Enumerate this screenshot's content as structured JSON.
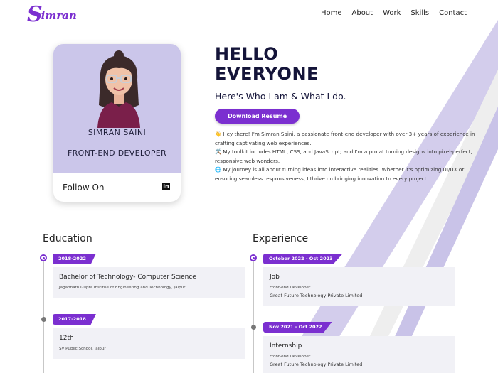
{
  "logo": {
    "initial": "S",
    "rest": "imran"
  },
  "nav": [
    {
      "label": "Home"
    },
    {
      "label": "About"
    },
    {
      "label": "Work"
    },
    {
      "label": "Skills"
    },
    {
      "label": "Contact"
    }
  ],
  "profile": {
    "name": "SIMRAN SAINI",
    "role": "FRONT-END DEVELOPER",
    "follow_label": "Follow On",
    "social_icon": "linkedin-icon"
  },
  "hero": {
    "line1": "HELLO",
    "line2": "EVERYONE",
    "tagline": "Here's Who I am & What I do.",
    "download_label": "Download Resume"
  },
  "about": [
    "👋 Hey there! I'm Simran Saini, a passionate front-end developer with over 3+ years of experience in crafting captivating web experiences.",
    "🛠️ My toolkit includes HTML, CSS, and JavaScript; and I'm a pro at turning designs into pixel-perfect, responsive web wonders.",
    "🌐 My journey is all about turning ideas into interactive realities. Whether it's optimizing UI/UX or ensuring seamless responsiveness, I thrive on bringing innovation to every project."
  ],
  "education": {
    "title": "Education",
    "items": [
      {
        "date": "2018-2022",
        "title": "Bachelor of Technology- Computer Science",
        "place": "Jagannath Gupta Institue of Engineering and Technology, Jaipur"
      },
      {
        "date": "2017-2018",
        "title": "12th",
        "place": "SV Public School, Jaipur"
      }
    ]
  },
  "experience": {
    "title": "Experience",
    "items": [
      {
        "date": "October 2022 - Oct 2023",
        "title": "Job",
        "role": "Front-end Developer",
        "company": "Great Future Technology Private Limited"
      },
      {
        "date": "Nov 2021 - Oct 2022",
        "title": "Internship",
        "role": "Front-end Developer",
        "company": "Great Future Technology Private Limited"
      }
    ]
  },
  "colors": {
    "accent": "#7b2fd0",
    "card_bg": "#cbc6ea",
    "stripe": "#cfc9ea",
    "entry_bg": "#f1f1f6"
  }
}
